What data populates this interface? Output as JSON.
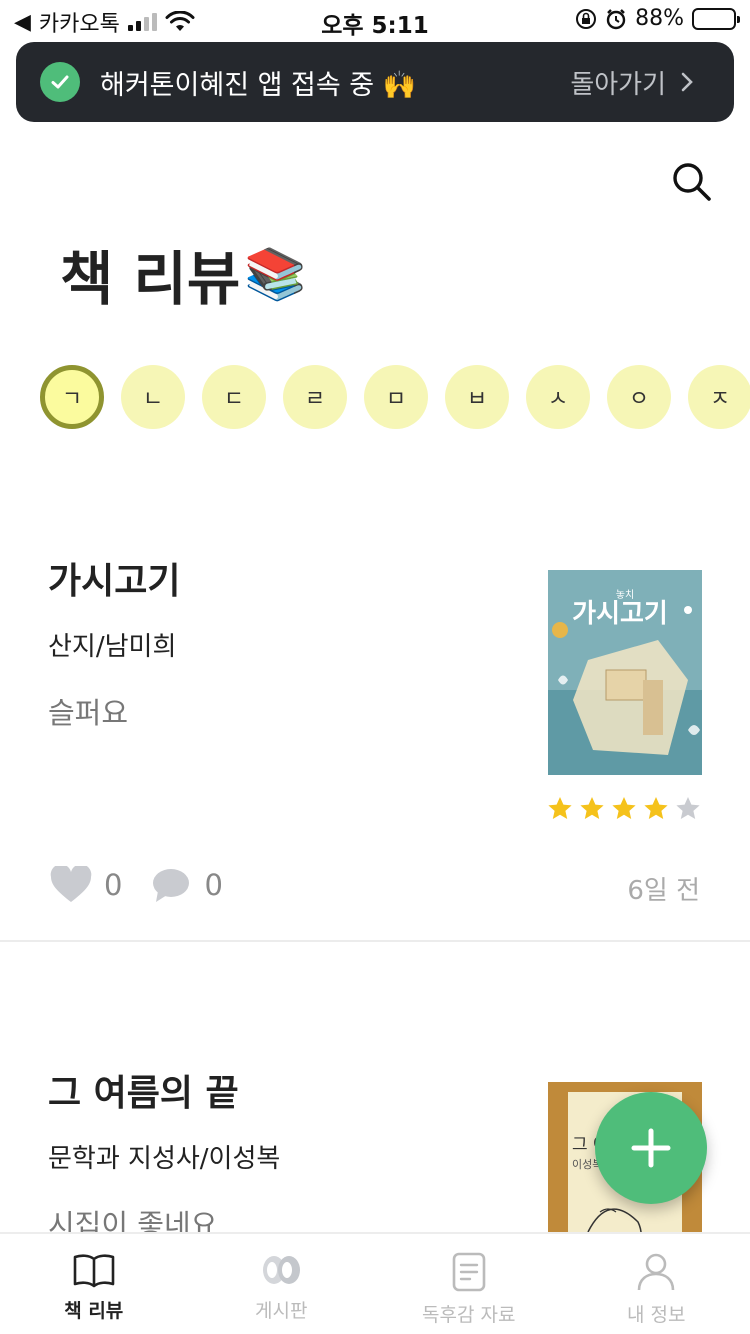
{
  "status_bar": {
    "back_app": "카카오톡",
    "time": "오후 5:11",
    "battery": "88%",
    "battery_level": 0.88
  },
  "banner": {
    "message": "해커톤이혜진 앱 접속 중 🙌",
    "back_label": "돌아가기"
  },
  "header": {
    "title": "책 리뷰",
    "title_emoji": "📚"
  },
  "filters": [
    "ㄱ",
    "ㄴ",
    "ㄷ",
    "ㄹ",
    "ㅁ",
    "ㅂ",
    "ㅅ",
    "ㅇ",
    "ㅈ"
  ],
  "active_filter": "ㄱ",
  "reviews": [
    {
      "title": "가시고기",
      "author": "산지/남미희",
      "comment": "슬퍼요",
      "rating": 4,
      "rating_max": 5,
      "likes": "0",
      "comments": "0",
      "date": "6일 전",
      "cover_text": "가시고기",
      "cover_small": "놓치",
      "cover_colors": {
        "bg": "#7fb0b8",
        "accent": "#f3e6c4"
      }
    },
    {
      "title": "그 여름의 끝",
      "author": "문학과 지성사/이성복",
      "comment": "시집이 좋네요",
      "cover_text": "그 여",
      "cover_small": "이성복",
      "cover_colors": {
        "bg": "#c08a3a",
        "accent": "#f4eccb"
      }
    }
  ],
  "colors": {
    "accent_green": "#4fbd7a",
    "chip_bg": "#f6f6b6",
    "chip_active_border": "#8f9430",
    "star_on": "#f5c21b",
    "star_off": "#c9cbd0"
  },
  "bottom_nav": [
    {
      "label": "책 리뷰",
      "icon": "book-icon",
      "active": true
    },
    {
      "label": "게시판",
      "icon": "board-icon",
      "active": false
    },
    {
      "label": "독후감 자료",
      "icon": "document-icon",
      "active": false
    },
    {
      "label": "내 정보",
      "icon": "user-icon",
      "active": false
    }
  ]
}
